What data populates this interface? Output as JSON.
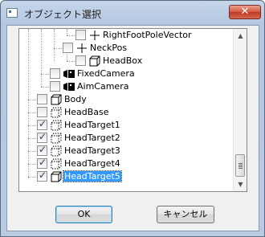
{
  "window": {
    "title": "オブジェクト選択",
    "close_glyph": "✕"
  },
  "tree": {
    "items": [
      {
        "label": "RightFootPoleVector",
        "checked": false,
        "icon": "cross-joint-icon"
      },
      {
        "label": "NeckPos",
        "checked": false,
        "icon": "cross-joint-icon"
      },
      {
        "label": "HeadBox",
        "checked": false,
        "icon": "cube-icon"
      },
      {
        "label": "FixedCamera",
        "checked": false,
        "icon": "camera-icon"
      },
      {
        "label": "AimCamera",
        "checked": false,
        "icon": "camera-icon"
      },
      {
        "label": "Body",
        "checked": false,
        "icon": "cube-icon"
      },
      {
        "label": "HeadBase",
        "checked": false,
        "icon": "dashed-cube-icon"
      },
      {
        "label": "HeadTarget1",
        "checked": true,
        "icon": "dashed-cube-icon"
      },
      {
        "label": "HeadTarget2",
        "checked": true,
        "icon": "dashed-cube-icon"
      },
      {
        "label": "HeadTarget3",
        "checked": true,
        "icon": "dashed-cube-icon"
      },
      {
        "label": "HeadTarget4",
        "checked": true,
        "icon": "dashed-cube-icon"
      },
      {
        "label": "HeadTarget5",
        "checked": true,
        "icon": "cube-icon",
        "selected": true
      }
    ]
  },
  "buttons": {
    "ok": "OK",
    "cancel": "キャンセル"
  }
}
